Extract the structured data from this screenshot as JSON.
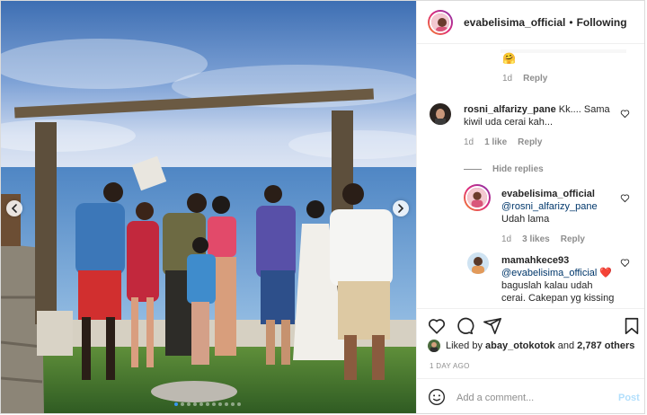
{
  "post": {
    "username": "evabelisima_official",
    "separator": "•",
    "follow_status": "Following"
  },
  "carousel": {
    "slide_count": 11,
    "active_index": 0
  },
  "comments": {
    "top_reply": {
      "emoji": "🤗",
      "age": "1d",
      "reply_label": "Reply"
    },
    "rosni": {
      "username": "rosni_alfarizy_pane",
      "text": "Kk.... Sama kiwil uda cerai kah...",
      "age": "1d",
      "likes": "1 like",
      "reply_label": "Reply"
    },
    "hide_replies_label": "Hide replies",
    "eva_reply": {
      "username": "evabelisima_official",
      "mention": "@rosni_alfarizy_pane",
      "text": "Udah lama",
      "age": "1d",
      "likes": "3 likes",
      "reply_label": "Reply"
    },
    "mamahkece": {
      "username": "mamahkece93",
      "mention": "@evabelisima_official",
      "emoji": "❤️",
      "text": "baguslah kalau udah cerai. Cakepan yg kissing"
    }
  },
  "actions": {
    "icons": [
      "heart-icon",
      "comment-icon",
      "share-icon",
      "bookmark-icon"
    ]
  },
  "likes": {
    "prefix": "Liked by",
    "user": "abay_otokotok",
    "joiner": "and",
    "others": "2,787 others"
  },
  "date": "1 DAY AGO",
  "composer": {
    "placeholder": "Add a comment...",
    "post_label": "Post"
  },
  "colors": {
    "accent_blue": "#0095f6",
    "post_disabled": "#b2dffc",
    "text_primary": "#262626",
    "text_secondary": "#8e8e8e",
    "mention": "#00376b",
    "heart_red": "#ed4956"
  }
}
